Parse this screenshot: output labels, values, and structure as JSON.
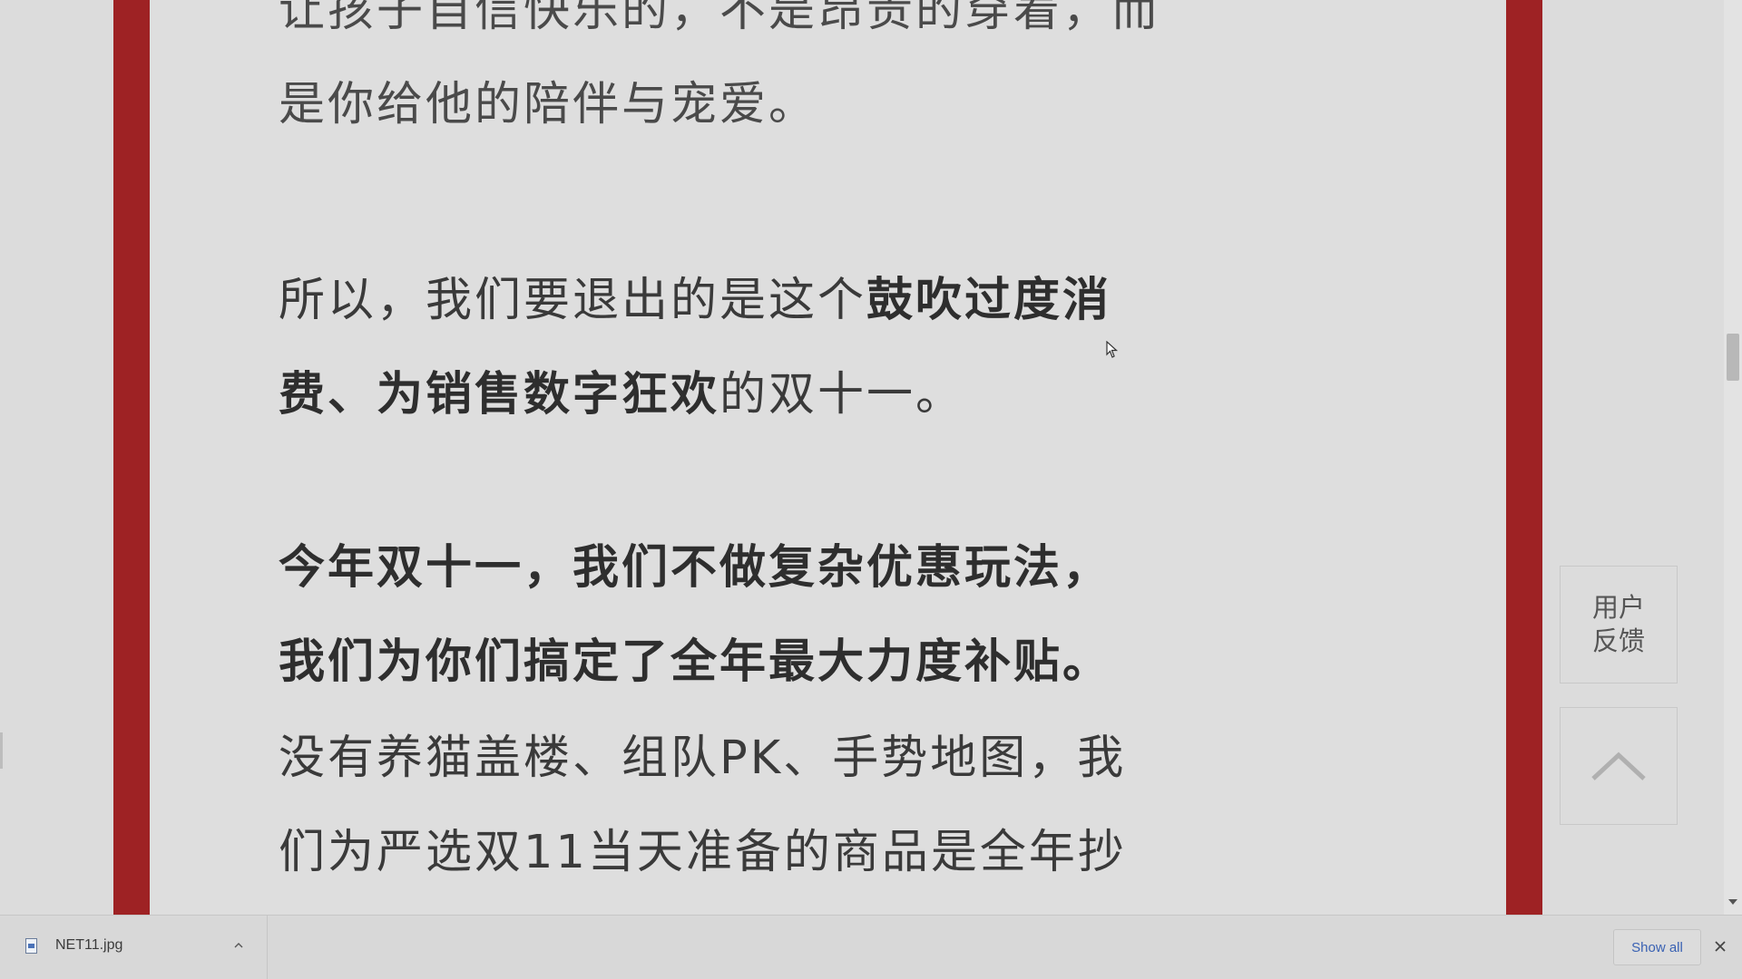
{
  "article": {
    "para1_line1": "让孩子自信快乐的，不是昂贵的穿着，而",
    "para1_line2": "是你给他的陪伴与宠爱。",
    "para2_line1_normal": "所以，我们要退出的是这个",
    "para2_line1_bold": "鼓吹过度消",
    "para2_line2_bold": "费、为销售数字狂欢",
    "para2_line2_normal": "的双十一。",
    "para3_line1": "今年双十一，我们不做复杂优惠玩法，",
    "para3_line2": "我们为你们搞定了全年最大力度补贴。",
    "para4_line1": "没有养猫盖楼、组队PK、手势地图，我",
    "para4_line2": "们为严选双11当天准备的商品是全年抄"
  },
  "side_buttons": {
    "feedback_line1": "用户",
    "feedback_line2": "反馈",
    "back_to_top_icon": "chevron-up-icon"
  },
  "download_bar": {
    "file_name": "NET11.jpg",
    "file_icon": "image-file-icon",
    "show_all_label": "Show all",
    "close_icon": "close-icon"
  },
  "colors": {
    "frame_red": "#9e2224",
    "page_bg": "#dedede",
    "link_blue": "#3a62b3"
  }
}
